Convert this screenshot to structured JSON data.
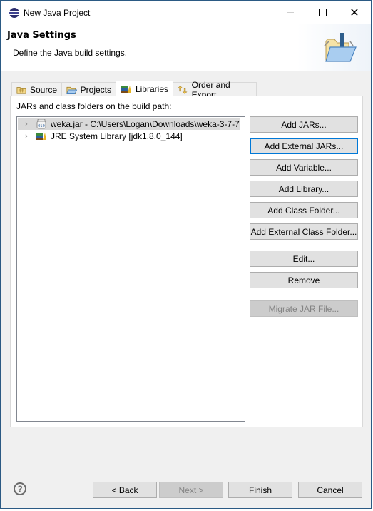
{
  "window": {
    "title": "New Java Project",
    "controls": {
      "minimize": "minimize",
      "maximize": "maximize",
      "close": "close"
    }
  },
  "header": {
    "title": "Java Settings",
    "description": "Define the Java build settings."
  },
  "tabs": [
    {
      "label": "Source",
      "icon": "source-folder-icon",
      "active": false
    },
    {
      "label": "Projects",
      "icon": "projects-folder-icon",
      "active": false
    },
    {
      "label": "Libraries",
      "icon": "libraries-icon",
      "active": true
    },
    {
      "label": "Order and Export",
      "icon": "order-export-icon",
      "active": false
    }
  ],
  "libraries": {
    "label": "JARs and class folders on the build path:",
    "entries": [
      {
        "label": "weka.jar - C:\\Users\\Logan\\Downloads\\weka-3-7-7",
        "icon": "jar-icon",
        "selected": true
      },
      {
        "label": "JRE System Library [jdk1.8.0_144]",
        "icon": "library-icon",
        "selected": false
      }
    ],
    "buttons": {
      "add_jars": "Add JARs...",
      "add_external_jars": "Add External JARs...",
      "add_variable": "Add Variable...",
      "add_library": "Add Library...",
      "add_class_folder": "Add Class Folder...",
      "add_external_class_folder": "Add External Class Folder...",
      "edit": "Edit...",
      "remove": "Remove",
      "migrate_jar": "Migrate JAR File..."
    }
  },
  "footer": {
    "help": "?",
    "back": "< Back",
    "next": "Next >",
    "finish": "Finish",
    "cancel": "Cancel"
  },
  "colors": {
    "accent": "#0078d7",
    "window_border": "#2b5a84",
    "selection": "#d9d9d9"
  }
}
